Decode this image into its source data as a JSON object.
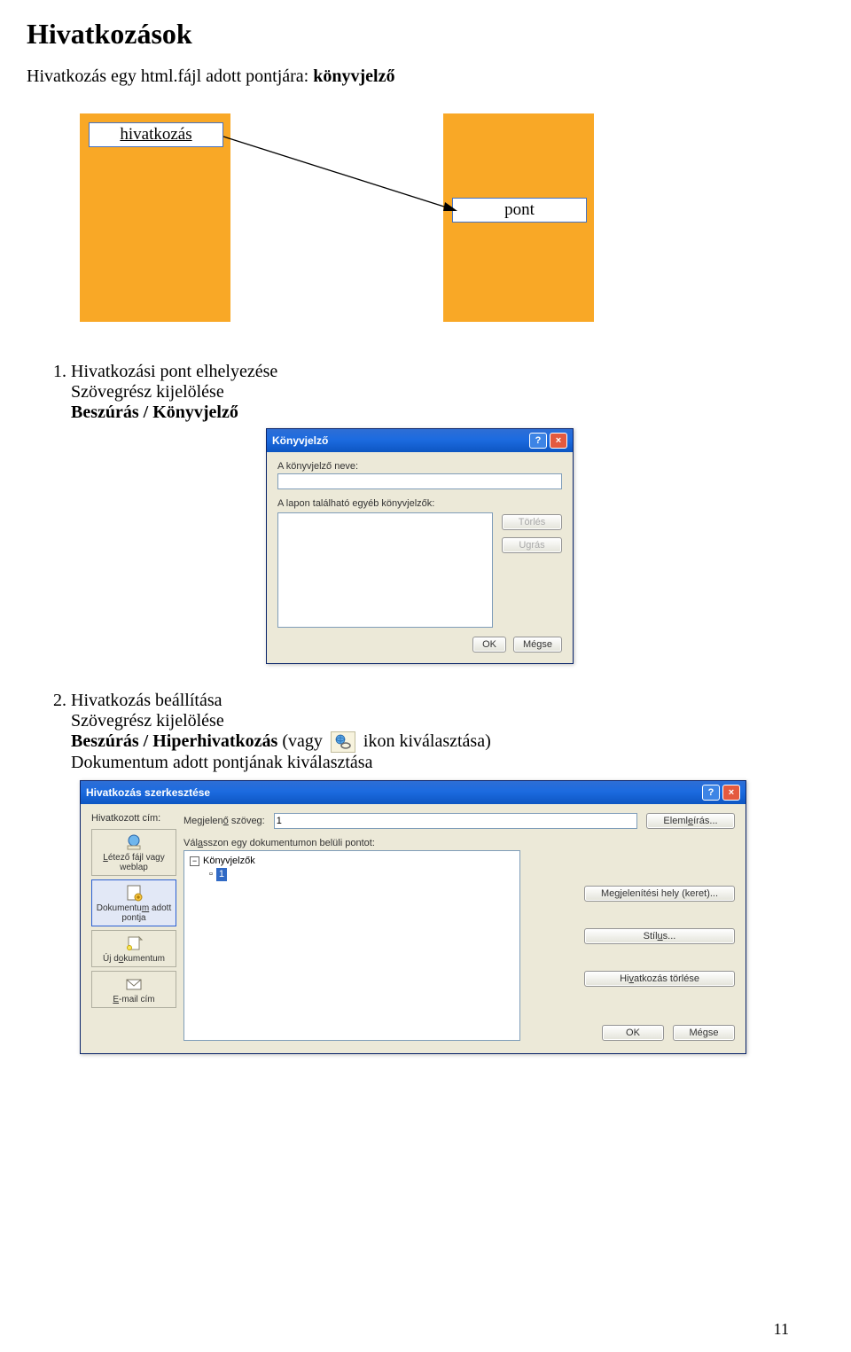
{
  "heading": "Hivatkozások",
  "intro_pre": "Hivatkozás egy html.fájl adott pontjára: ",
  "intro_bold": "könyvjelző",
  "diagram": {
    "left_label": "hivatkozás",
    "right_label": "pont"
  },
  "step1": {
    "title": "Hivatkozási pont elhelyezése",
    "line_a": "Szövegrész kijelölése",
    "line_b": "Beszúrás / Könyvjelző"
  },
  "step2": {
    "title": "Hivatkozás beállítása",
    "line_a": "Szövegrész kijelölése",
    "line_b_pre": "Beszúrás / Hiperhivatkozás",
    "line_b_mid": " (vagy ",
    "line_b_post": " ikon kiválasztása)",
    "line_c": "Dokumentum adott pontjának kiválasztása"
  },
  "dlg_bm": {
    "title": "Könyvjelző",
    "name_label": "A könyvjelző neve:",
    "list_label": "A lapon található egyéb könyvjelzők:",
    "btn_delete": "Törlés",
    "btn_goto": "Ugrás",
    "btn_ok": "OK",
    "btn_cancel": "Mégse"
  },
  "dlg_hl": {
    "title": "Hivatkozás szerkesztése",
    "side_head": "Hivatkozott cím:",
    "side_items": [
      "Létező fájl vagy weblap",
      "Dokumentum adott pontja",
      "Új dokumentum",
      "E-mail cím"
    ],
    "disp_label": "Megjelenő szöveg:",
    "disp_value": "1",
    "btn_tip": "Elemleírás...",
    "pick_label": "Válasszon egy dokumentumon belüli pontot:",
    "tree_root": "Könyvjelzők",
    "tree_sel": "1",
    "btn_frame": "Megjelenítési hely (keret)...",
    "btn_style": "Stílus...",
    "btn_remove": "Hivatkozás törlése",
    "btn_ok": "OK",
    "btn_cancel": "Mégse"
  },
  "pagenum": "11"
}
